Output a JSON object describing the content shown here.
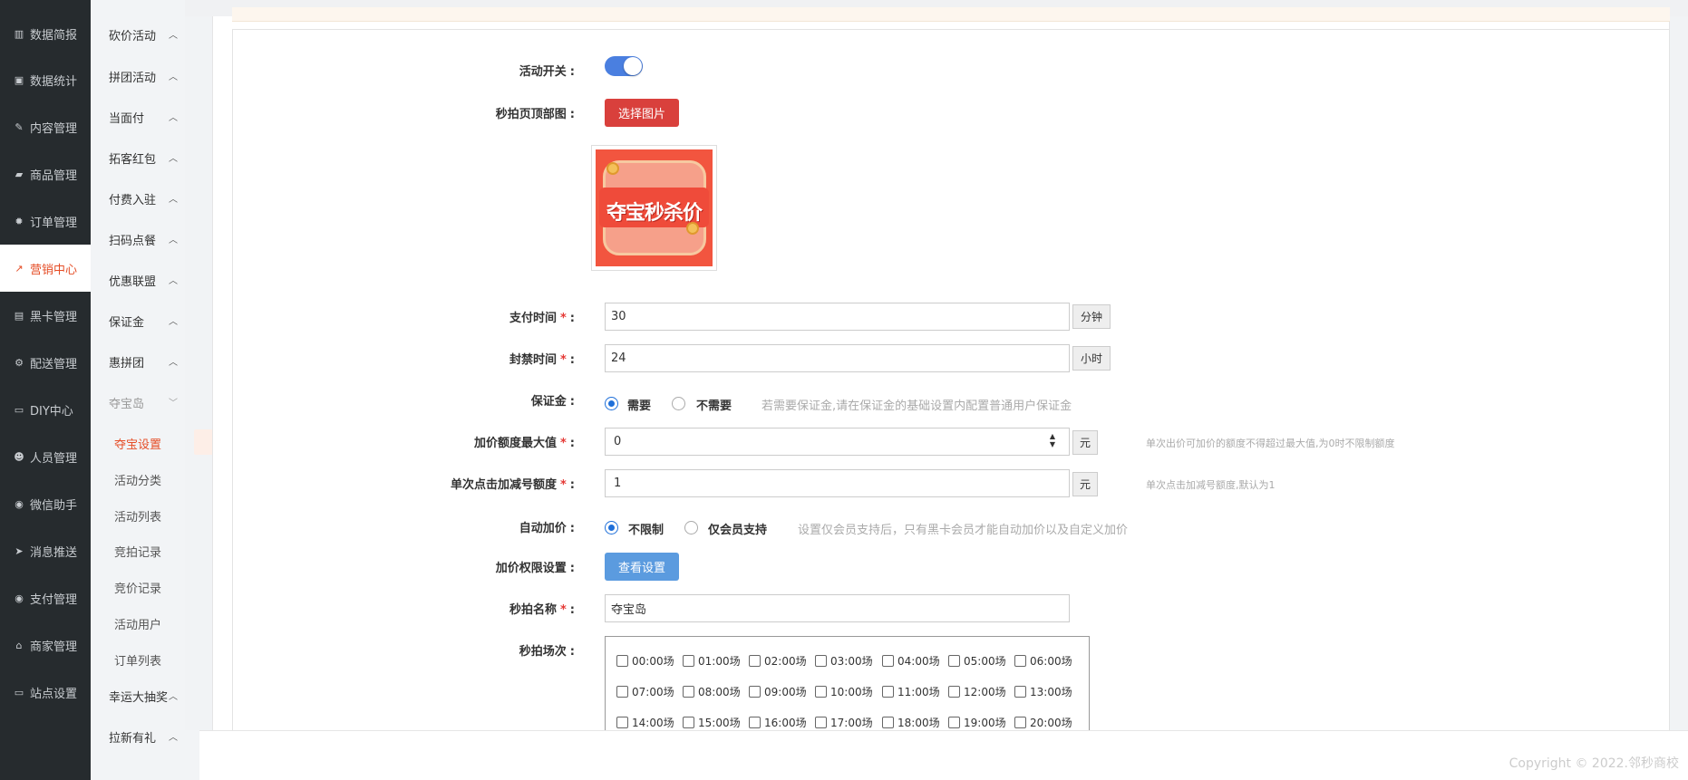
{
  "primary_nav": [
    {
      "label": "数据简报",
      "icon": "bar-chart-icon",
      "glyph": "▥",
      "active": false
    },
    {
      "label": "数据统计",
      "icon": "money-icon",
      "glyph": "▣",
      "active": false
    },
    {
      "label": "内容管理",
      "icon": "tags-icon",
      "glyph": "✎",
      "active": false
    },
    {
      "label": "商品管理",
      "icon": "shopping-bag-icon",
      "glyph": "▰",
      "active": false
    },
    {
      "label": "订单管理",
      "icon": "gear-icon",
      "glyph": "✹",
      "active": false
    },
    {
      "label": "营销中心",
      "icon": "line-chart-icon",
      "glyph": "↗",
      "active": true
    },
    {
      "label": "黑卡管理",
      "icon": "id-card-icon",
      "glyph": "▤",
      "active": false
    },
    {
      "label": "配送管理",
      "icon": "motorcycle-icon",
      "glyph": "⚙",
      "active": false
    },
    {
      "label": "DIY中心",
      "icon": "monitor-icon",
      "glyph": "▭",
      "active": false
    },
    {
      "label": "人员管理",
      "icon": "users-icon",
      "glyph": "☻",
      "active": false
    },
    {
      "label": "微信助手",
      "icon": "wechat-icon",
      "glyph": "◉",
      "active": false
    },
    {
      "label": "消息推送",
      "icon": "paper-plane-icon",
      "glyph": "➤",
      "active": false
    },
    {
      "label": "支付管理",
      "icon": "wechat-pay-icon",
      "glyph": "◉",
      "active": false
    },
    {
      "label": "商家管理",
      "icon": "bank-icon",
      "glyph": "⌂",
      "active": false
    },
    {
      "label": "站点设置",
      "icon": "desktop-icon",
      "glyph": "▭",
      "active": false
    }
  ],
  "secondary_nav": [
    {
      "label": "砍价活动"
    },
    {
      "label": "拼团活动"
    },
    {
      "label": "当面付"
    },
    {
      "label": "拓客红包"
    },
    {
      "label": "付费入驻"
    },
    {
      "label": "扫码点餐"
    },
    {
      "label": "优惠联盟"
    },
    {
      "label": "保证金"
    },
    {
      "label": "惠拼团"
    },
    {
      "label": "夺宝岛"
    }
  ],
  "secondary_sub": [
    {
      "label": "夺宝设置",
      "active": true
    },
    {
      "label": "活动分类"
    },
    {
      "label": "活动列表"
    },
    {
      "label": "竞拍记录"
    },
    {
      "label": "竞价记录"
    },
    {
      "label": "活动用户"
    },
    {
      "label": "订单列表"
    }
  ],
  "secondary_nav_bottom": [
    {
      "label": "幸运大抽奖"
    },
    {
      "label": "拉新有礼"
    }
  ],
  "form": {
    "switch_label": "活动开关",
    "switch_on": true,
    "banner_label": "秒拍页顶部图",
    "choose_image_button": "选择图片",
    "banner_image_text": "夺宝秒杀价",
    "pay_time_label": "支付时间",
    "pay_time_value": "30",
    "pay_time_unit": "分钟",
    "ban_time_label": "封禁时间",
    "ban_time_value": "24",
    "ban_time_unit": "小时",
    "deposit_label": "保证金",
    "deposit_opt_yes": "需要",
    "deposit_opt_no": "不需要",
    "deposit_hint": "若需要保证金,请在保证金的基础设置内配置普通用户保证金",
    "max_bid_label": "加价额度最大值",
    "max_bid_value": "0",
    "max_bid_unit": "元",
    "max_bid_hint": "单次出价可加价的额度不得超过最大值,为0时不限制额度",
    "step_label": "单次点击加减号额度",
    "step_value": "1",
    "step_unit": "元",
    "step_hint": "单次点击加减号额度,默认为1",
    "auto_bid_label": "自动加价",
    "auto_opt_unlimited": "不限制",
    "auto_opt_member": "仅会员支持",
    "auto_hint": "设置仅会员支持后，只有黑卡会员才能自动加价以及自定义加价",
    "perm_label": "加价权限设置",
    "perm_button": "查看设置",
    "name_label": "秒拍名称",
    "name_value": "夺宝岛",
    "slots_label": "秒拍场次",
    "slots": [
      "00:00场",
      "01:00场",
      "02:00场",
      "03:00场",
      "04:00场",
      "05:00场",
      "06:00场",
      "07:00场",
      "08:00场",
      "09:00场",
      "10:00场",
      "11:00场",
      "12:00场",
      "13:00场",
      "14:00场",
      "15:00场",
      "16:00场",
      "17:00场",
      "18:00场",
      "19:00场",
      "20:00场"
    ]
  },
  "footer": {
    "copyright": "Copyright © 2022.邻秒商校"
  },
  "colors": {
    "nav_dark": "#262b2e",
    "accent_orange": "#e54d26",
    "button_red": "#d9403c",
    "button_blue": "#5b9bdf",
    "toggle_blue": "#4a7fe0",
    "required_star": "#e53935"
  }
}
